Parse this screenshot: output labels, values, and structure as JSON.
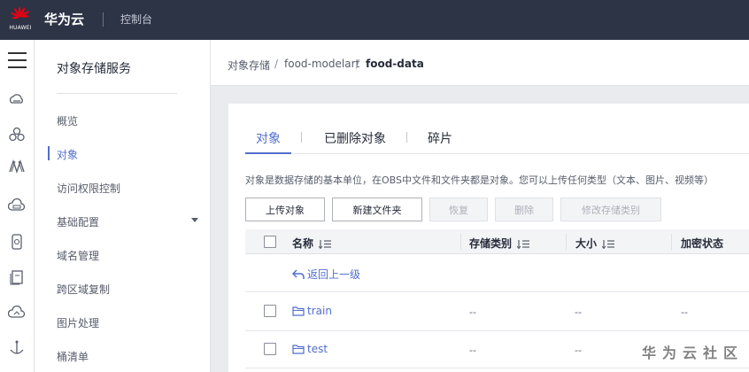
{
  "header": {
    "logo_text": "HUAWEI",
    "brand": "华为云",
    "console_label": "控制台"
  },
  "rail_icons": [
    "menu-icon",
    "cloud-server-icon",
    "cloud-services-icon",
    "network-icon",
    "storage-cloud-icon",
    "database-icon",
    "document-icon",
    "cloud-monitor-icon",
    "anchor-icon"
  ],
  "sidebar": {
    "title": "对象存储服务",
    "items": [
      {
        "label": "概览"
      },
      {
        "label": "对象",
        "active": true
      },
      {
        "label": "访问权限控制"
      },
      {
        "label": "基础配置",
        "has_dropdown": true
      },
      {
        "label": "域名管理"
      },
      {
        "label": "跨区域复制"
      },
      {
        "label": "图片处理"
      },
      {
        "label": "桶清单"
      }
    ]
  },
  "breadcrumb": {
    "root": "对象存储",
    "bucket": "food-modelart",
    "current": "food-data",
    "separator": "/"
  },
  "tabs": [
    {
      "label": "对象",
      "active": true
    },
    {
      "label": "已删除对象"
    },
    {
      "label": "碎片"
    }
  ],
  "description": "对象是数据存储的基本单位，在OBS中文件和文件夹都是对象。您可以上传任何类型（文本、图片、视频等）",
  "toolbar": {
    "upload": "上传对象",
    "new_folder": "新建文件夹",
    "restore": "恢复",
    "delete": "删除",
    "modify_storage_class": "修改存储类别"
  },
  "table": {
    "columns": {
      "name": "名称",
      "storage_class": "存储类别",
      "size": "大小",
      "encryption": "加密状态"
    },
    "back_label": "返回上一级",
    "rows": [
      {
        "name": "train",
        "storage_class": "--",
        "size": "--",
        "encryption": "--"
      },
      {
        "name": "test",
        "storage_class": "--",
        "size": "--",
        "encryption": ""
      }
    ]
  },
  "watermark": "华为云社区",
  "colors": {
    "accent": "#526ecc",
    "topbar": "#2d3446",
    "logo_red": "#e60012"
  }
}
